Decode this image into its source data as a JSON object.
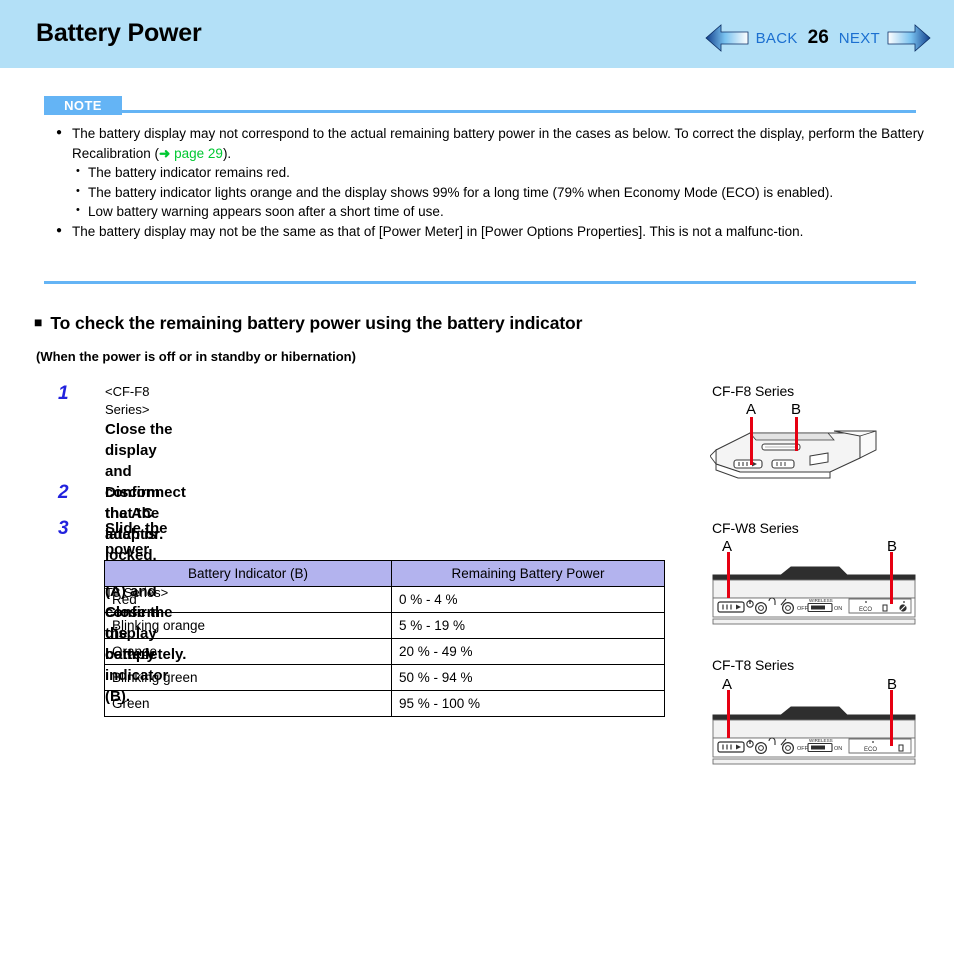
{
  "header": {
    "title": "Battery Power",
    "back_label": "BACK",
    "page_number": "26",
    "next_label": "NEXT",
    "band_color": "#b3e0f7",
    "nav_text_color": "#1b6fd0"
  },
  "note": {
    "badge_label": "NOTE",
    "badge_color": "#64b4f5",
    "rule_color": "#64b4f5",
    "bullets": [
      {
        "text_before": "The battery display may not correspond to the actual remaining battery power in the cases as below. To correct the display, perform the Battery Recalibration (",
        "arrow": "➜",
        "link": "page 29",
        "text_after": ")."
      },
      {
        "text": "The battery display may not be the same as that of [Power Meter] in [Power Options Properties]. This is not a malfunc-tion."
      }
    ],
    "sub_bullets": [
      "The battery indicator remains red.",
      "The battery indicator lights orange and the display shows 99% for a long time (79% when Economy Mode (ECO) is enabled).",
      "Low battery warning appears soon after a short time of use."
    ],
    "link_color": "#00c832"
  },
  "section": {
    "marker": "■",
    "heading": "To check the remaining battery power using the battery indicator",
    "subheading": "(When the power is off or in standby or hibernation)"
  },
  "steps": [
    {
      "num": "1",
      "lines": [
        {
          "text": "<CF-F8 Series>",
          "style": "small"
        },
        {
          "text": "Close the display and confirm that the latch is locked.",
          "style": "bold"
        },
        {
          "text": "<CF-W8/CF-T8 Series>",
          "style": "small"
        },
        {
          "text": "Close the display completely.",
          "style": "bold"
        }
      ]
    },
    {
      "num": "2",
      "lines": [
        {
          "text": "Disconnect the AC adaptor.",
          "style": "bold"
        }
      ]
    },
    {
      "num": "3",
      "lines": [
        {
          "text": "Slide the power switch (A) and confirm the battery indicator (B).",
          "style": "bold"
        }
      ]
    }
  ],
  "table": {
    "header_bg": "#b3b3ee",
    "columns": [
      "Battery Indicator (B)",
      "Remaining Battery Power"
    ],
    "rows": [
      [
        "Red",
        "0 % - 4 %"
      ],
      [
        "Blinking orange",
        "5 % - 19 %"
      ],
      [
        "Orange",
        "20 % - 49 %"
      ],
      [
        "Blinking green",
        "50 % - 94 %"
      ],
      [
        "Green",
        "95 % - 100 %"
      ]
    ]
  },
  "illustrations": [
    {
      "title": "CF-F8 Series",
      "callout_a": "A",
      "callout_b": "B",
      "callout_color": "#e60012"
    },
    {
      "title": "CF-W8 Series",
      "callout_a": "A",
      "callout_b": "B",
      "callout_color": "#e60012",
      "strip_labels": [
        "WIRELESS",
        "OFF",
        "ON",
        "ECO"
      ]
    },
    {
      "title": "CF-T8 Series",
      "callout_a": "A",
      "callout_b": "B",
      "callout_color": "#e60012",
      "strip_labels": [
        "WIRELESS",
        "OFF",
        "ON",
        "ECO"
      ]
    }
  ]
}
